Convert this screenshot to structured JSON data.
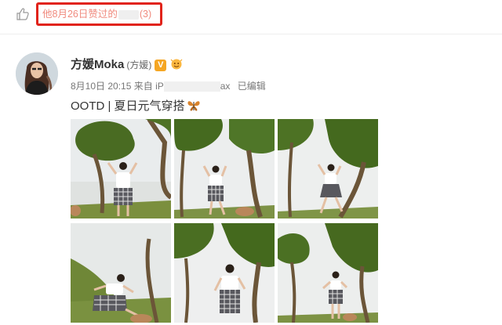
{
  "like_notice": {
    "text_before": "他8月26日赞过的",
    "text_after": "(3)",
    "icon": "thumbs-up-icon"
  },
  "post": {
    "author_name": "方媛Moka",
    "author_alias": "(方媛)",
    "verified_badge": "V",
    "date": "8月10日 20:15",
    "source_prefix": "来自 iP",
    "source_suffix": "ax",
    "edited": "已编辑",
    "content": "OOTD | 夏日元气穿搭",
    "content_emoji": "butterfly-icon",
    "photos": [
      {
        "alt": "photo-1"
      },
      {
        "alt": "photo-2"
      },
      {
        "alt": "photo-3"
      },
      {
        "alt": "photo-4"
      },
      {
        "alt": "photo-5"
      },
      {
        "alt": "photo-6"
      }
    ]
  },
  "colors": {
    "highlight_border": "#e1231a",
    "liked_text": "#f08a7e",
    "verified": "#f5a623",
    "text": "#333333",
    "meta": "#777777"
  }
}
